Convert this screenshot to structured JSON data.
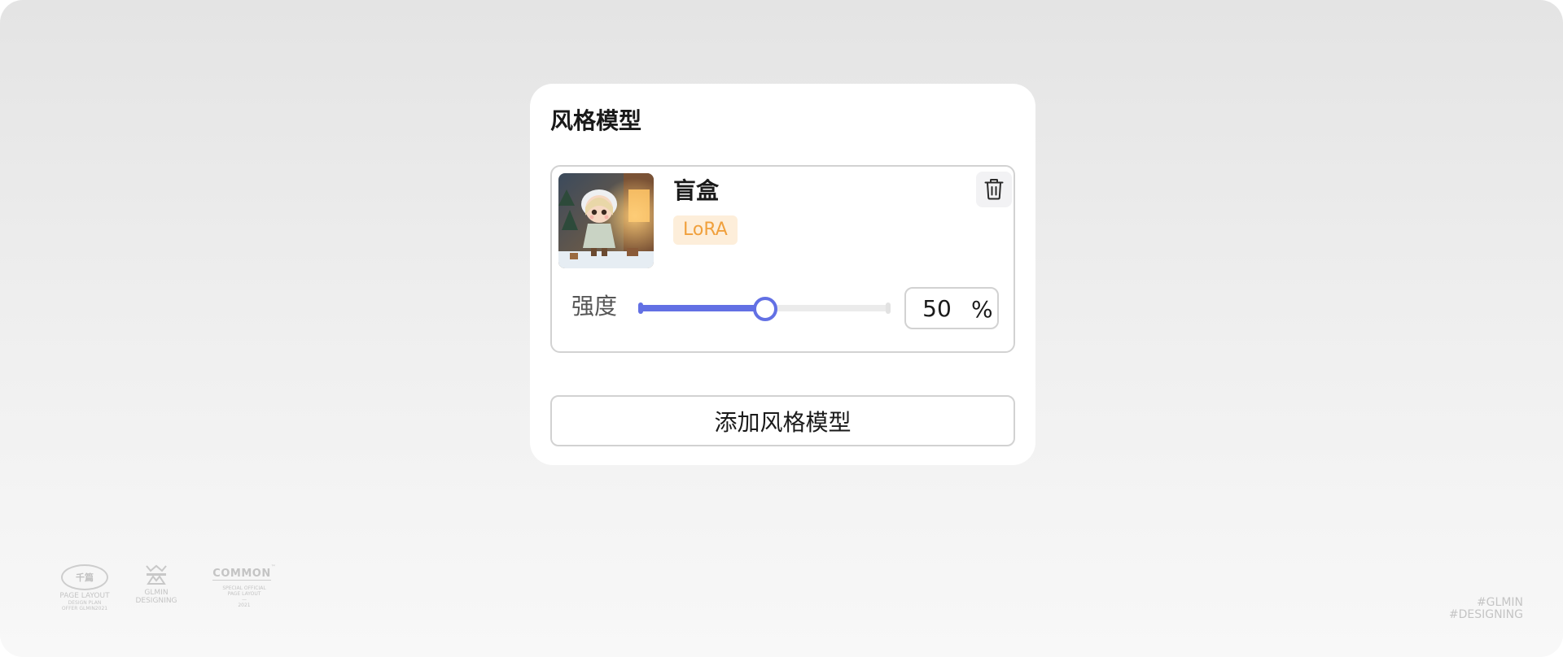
{
  "panel": {
    "title": "风格模型",
    "add_button_label": "添加风格模型"
  },
  "model": {
    "name": "盲盒",
    "tag": "LoRA",
    "strength_label": "强度",
    "strength_value": "50",
    "strength_unit": "%",
    "strength_percent": 50
  },
  "footer": {
    "brand_1": {
      "logo_text": "千篇",
      "name": "PAGE LAYOUT",
      "line_1": "DESIGN PLAN",
      "line_2": "OFFER GLMIN2021"
    },
    "brand_2": {
      "name": "GLMIN",
      "line_1": "DESIGNING"
    },
    "brand_3": {
      "logo_text": "COMMON",
      "mark": "™",
      "line_1": "SPECIAL OFFICIAL",
      "line_2": "PAGE LAYOUT",
      "line_3": "—",
      "line_4": "2021"
    },
    "hashtag_1": "#GLMIN",
    "hashtag_2": "#DESIGNING"
  },
  "colors": {
    "accent": "#6270e4",
    "tag_bg": "#fdeeda",
    "tag_text": "#f0a03c"
  },
  "icons": {
    "delete": "trash-icon",
    "thumbnail": "blind-box-figure-thumbnail"
  }
}
